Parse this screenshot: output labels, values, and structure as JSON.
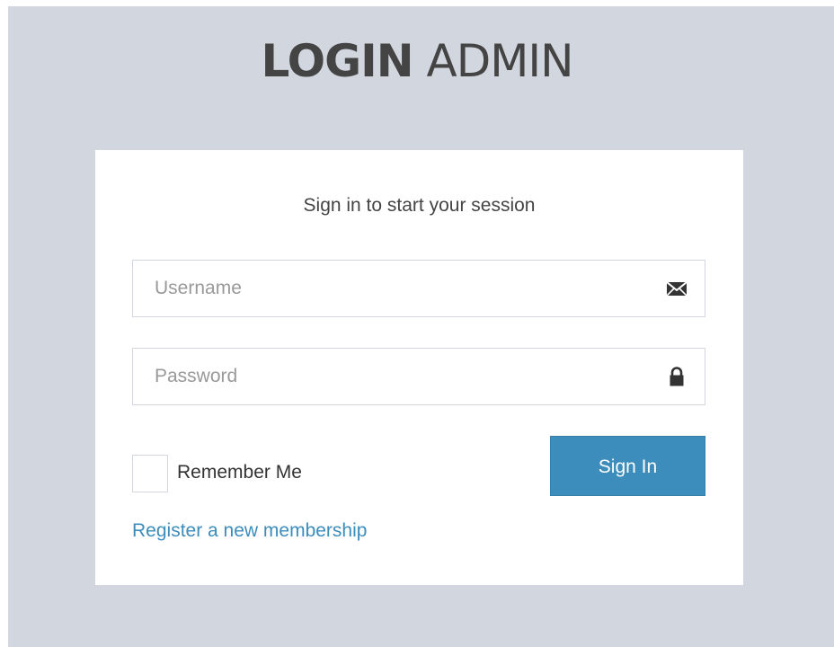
{
  "logo": {
    "bold": "LOGIN",
    "light": "ADMIN"
  },
  "login_box": {
    "message": "Sign in to start your session",
    "username": {
      "placeholder": "Username",
      "value": "",
      "icon": "envelope-icon"
    },
    "password": {
      "placeholder": "Password",
      "value": "",
      "icon": "lock-icon"
    },
    "remember_label": "Remember Me",
    "remember_checked": false,
    "signin_label": "Sign In",
    "register_label": "Register a new membership"
  },
  "colors": {
    "background": "#d2d6de",
    "primary": "#3c8dbc",
    "text": "#444444"
  }
}
